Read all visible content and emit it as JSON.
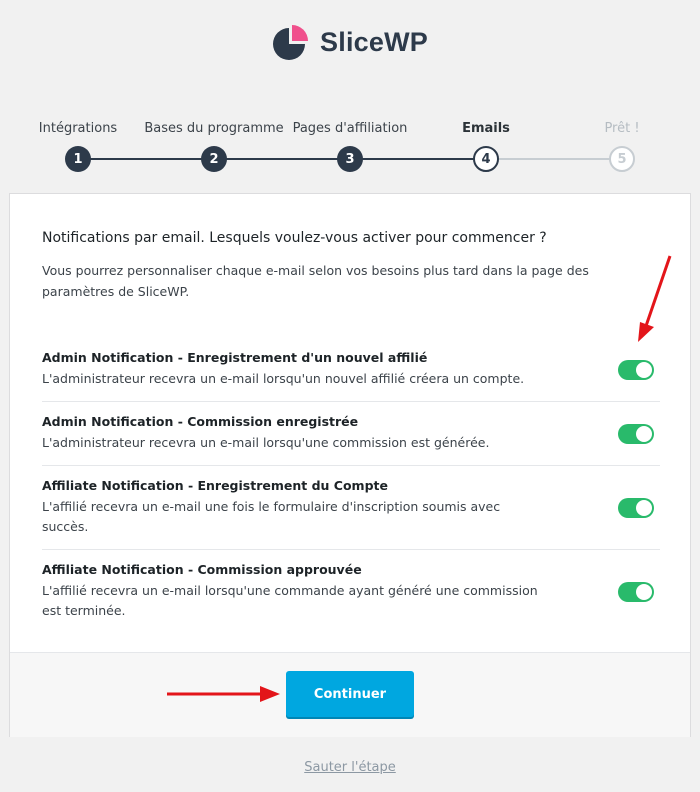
{
  "brand": {
    "name": "SliceWP",
    "primary": "#2d3a4a",
    "accent": "#f0508c"
  },
  "steps": [
    {
      "label": "Intégrations",
      "number": "1",
      "state": "done"
    },
    {
      "label": "Bases du programme",
      "number": "2",
      "state": "done"
    },
    {
      "label": "Pages d'affiliation",
      "number": "3",
      "state": "done"
    },
    {
      "label": "Emails",
      "number": "4",
      "state": "current"
    },
    {
      "label": "Prêt !",
      "number": "5",
      "state": "future"
    }
  ],
  "card": {
    "title": "Notifications par email. Lesquels voulez-vous activer pour commencer ?",
    "description": "Vous pourrez personnaliser chaque e-mail selon vos besoins plus tard dans la page des paramètres de SliceWP."
  },
  "notifications": [
    {
      "title": "Admin Notification - Enregistrement d'un nouvel affilié",
      "description": "L'administrateur recevra un e-mail lorsqu'un nouvel affilié créera un compte.",
      "enabled": true
    },
    {
      "title": "Admin Notification - Commission enregistrée",
      "description": "L'administrateur recevra un e-mail lorsqu'une commission est générée.",
      "enabled": true
    },
    {
      "title": "Affiliate Notification - Enregistrement du Compte",
      "description": "L'affilié recevra un e-mail une fois le formulaire d'inscription soumis avec succès.",
      "enabled": true
    },
    {
      "title": "Affiliate Notification - Commission approuvée",
      "description": "L'affilié recevra un e-mail lorsqu'une commande ayant généré une commission est terminée.",
      "enabled": true
    }
  ],
  "actions": {
    "continue_label": "Continuer",
    "skip_label": "Sauter l'étape"
  },
  "colors": {
    "toggle_on": "#29ba6b",
    "button": "#00a7e0",
    "annotation_arrow": "#e3151a"
  }
}
